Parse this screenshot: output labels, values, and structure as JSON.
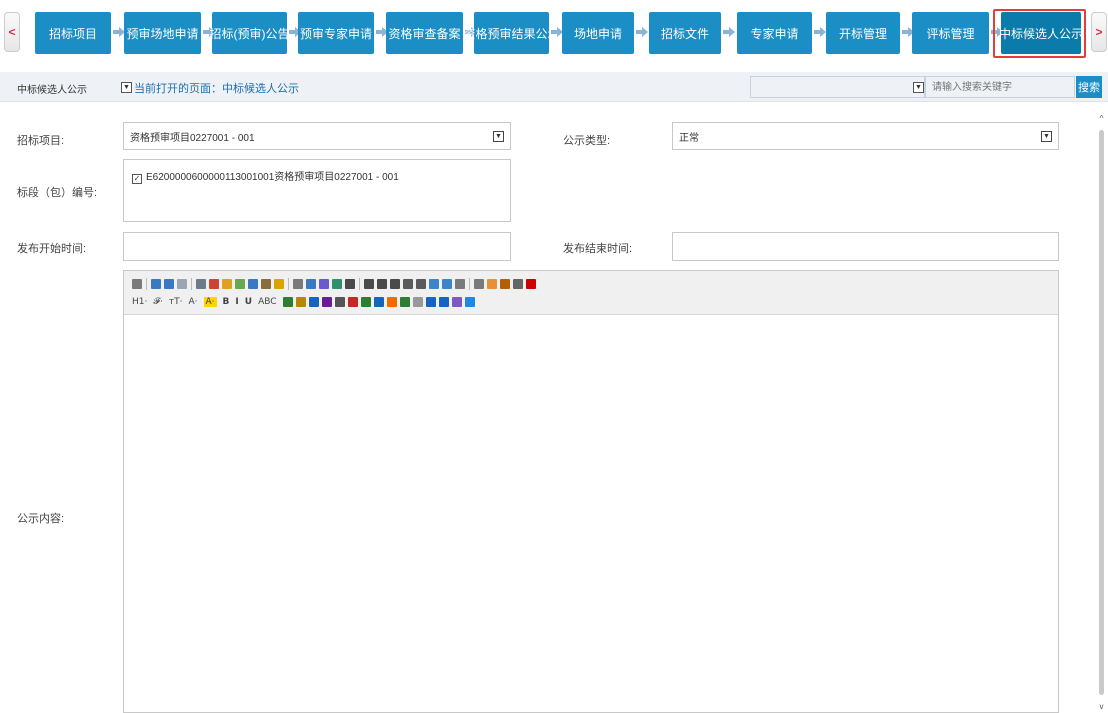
{
  "nav": {
    "prev": "<",
    "next": ">",
    "steps": [
      "招标项目",
      "预审场地申请",
      "招标(预审)公告",
      "预审专家申请",
      "资格审查备案",
      "资格预审结果公示",
      "场地申请",
      "招标文件",
      "专家申请",
      "开标管理",
      "评标管理",
      "中标候选人公示"
    ],
    "active_index": 11
  },
  "toolbar": {
    "page_select_value": "中标候选人公示",
    "current_page": "当前打开的页面：中标候选人公示",
    "search_placeholder": "请输入搜索关键字",
    "search_button": "搜索"
  },
  "form": {
    "project_label": "招标项目:",
    "project_value": "资格预审项目0227001 - 001",
    "notice_type_label": "公示类型:",
    "notice_type_value": "正常",
    "section_label": "标段（包）编号:",
    "section_item": "E62000006000001130010​01资格预审项目0227001 - 001",
    "publish_start_label": "发布开始时间:",
    "publish_end_label": "发布结束时间:",
    "content_label": "公示内容:"
  },
  "editor": {
    "row2_text": [
      "H1·",
      "𝓕·",
      "тT·",
      "A·",
      "A·",
      "B",
      "I",
      "U",
      "ABC"
    ]
  },
  "colors": {
    "step_blue": "#1b8ec6",
    "active_outline": "#e53b3b",
    "link_blue": "#1e6fae"
  }
}
